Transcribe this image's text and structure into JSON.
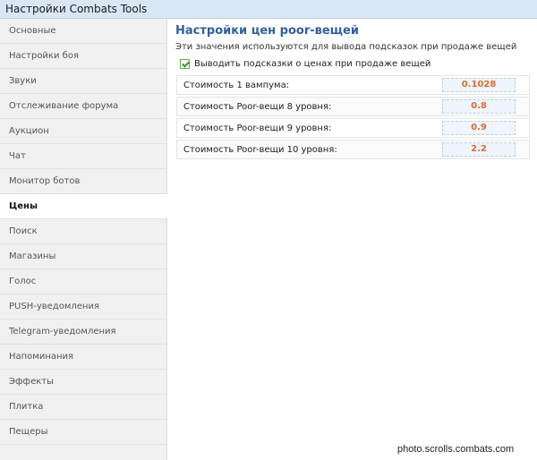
{
  "window": {
    "title": "Настройки Combats Tools"
  },
  "sidebar": {
    "items": [
      {
        "label": "Основные"
      },
      {
        "label": "Настройки боя"
      },
      {
        "label": "Звуки"
      },
      {
        "label": "Отслеживание форума"
      },
      {
        "label": "Аукцион"
      },
      {
        "label": "Чат"
      },
      {
        "label": "Монитор ботов"
      },
      {
        "label": "Цены",
        "active": true
      },
      {
        "label": "Поиск"
      },
      {
        "label": "Магазины"
      },
      {
        "label": "Голос"
      },
      {
        "label": "PUSH-уведомления"
      },
      {
        "label": "Telegram-уведомления"
      },
      {
        "label": "Напоминания"
      },
      {
        "label": "Эффекты"
      },
      {
        "label": "Плитка"
      },
      {
        "label": "Пещеры"
      }
    ]
  },
  "main": {
    "heading": "Настройки цен poor-вещей",
    "description": "Эти значения используются для вывода подсказок при продаже вещей",
    "show_hints": {
      "label": "Выводить подсказки о ценах при продаже вещей",
      "checked": true
    },
    "prices": [
      {
        "label": "Стоимость 1 вампума:",
        "value": "0.1028"
      },
      {
        "label": "Стоимость Poor-вещи 8 уровня:",
        "value": "0.8"
      },
      {
        "label": "Стоимость Poor-вещи 9 уровня:",
        "value": "0.9"
      },
      {
        "label": "Стоимость Poor-вещи 10 уровня:",
        "value": "2.2"
      }
    ]
  },
  "watermark": "photo.scrolls.combats.com",
  "colors": {
    "accent": "#2f5fa3",
    "value": "#e06b2d",
    "titlebar": "#d9e7f5",
    "sidebar": "#f0f0f0"
  }
}
